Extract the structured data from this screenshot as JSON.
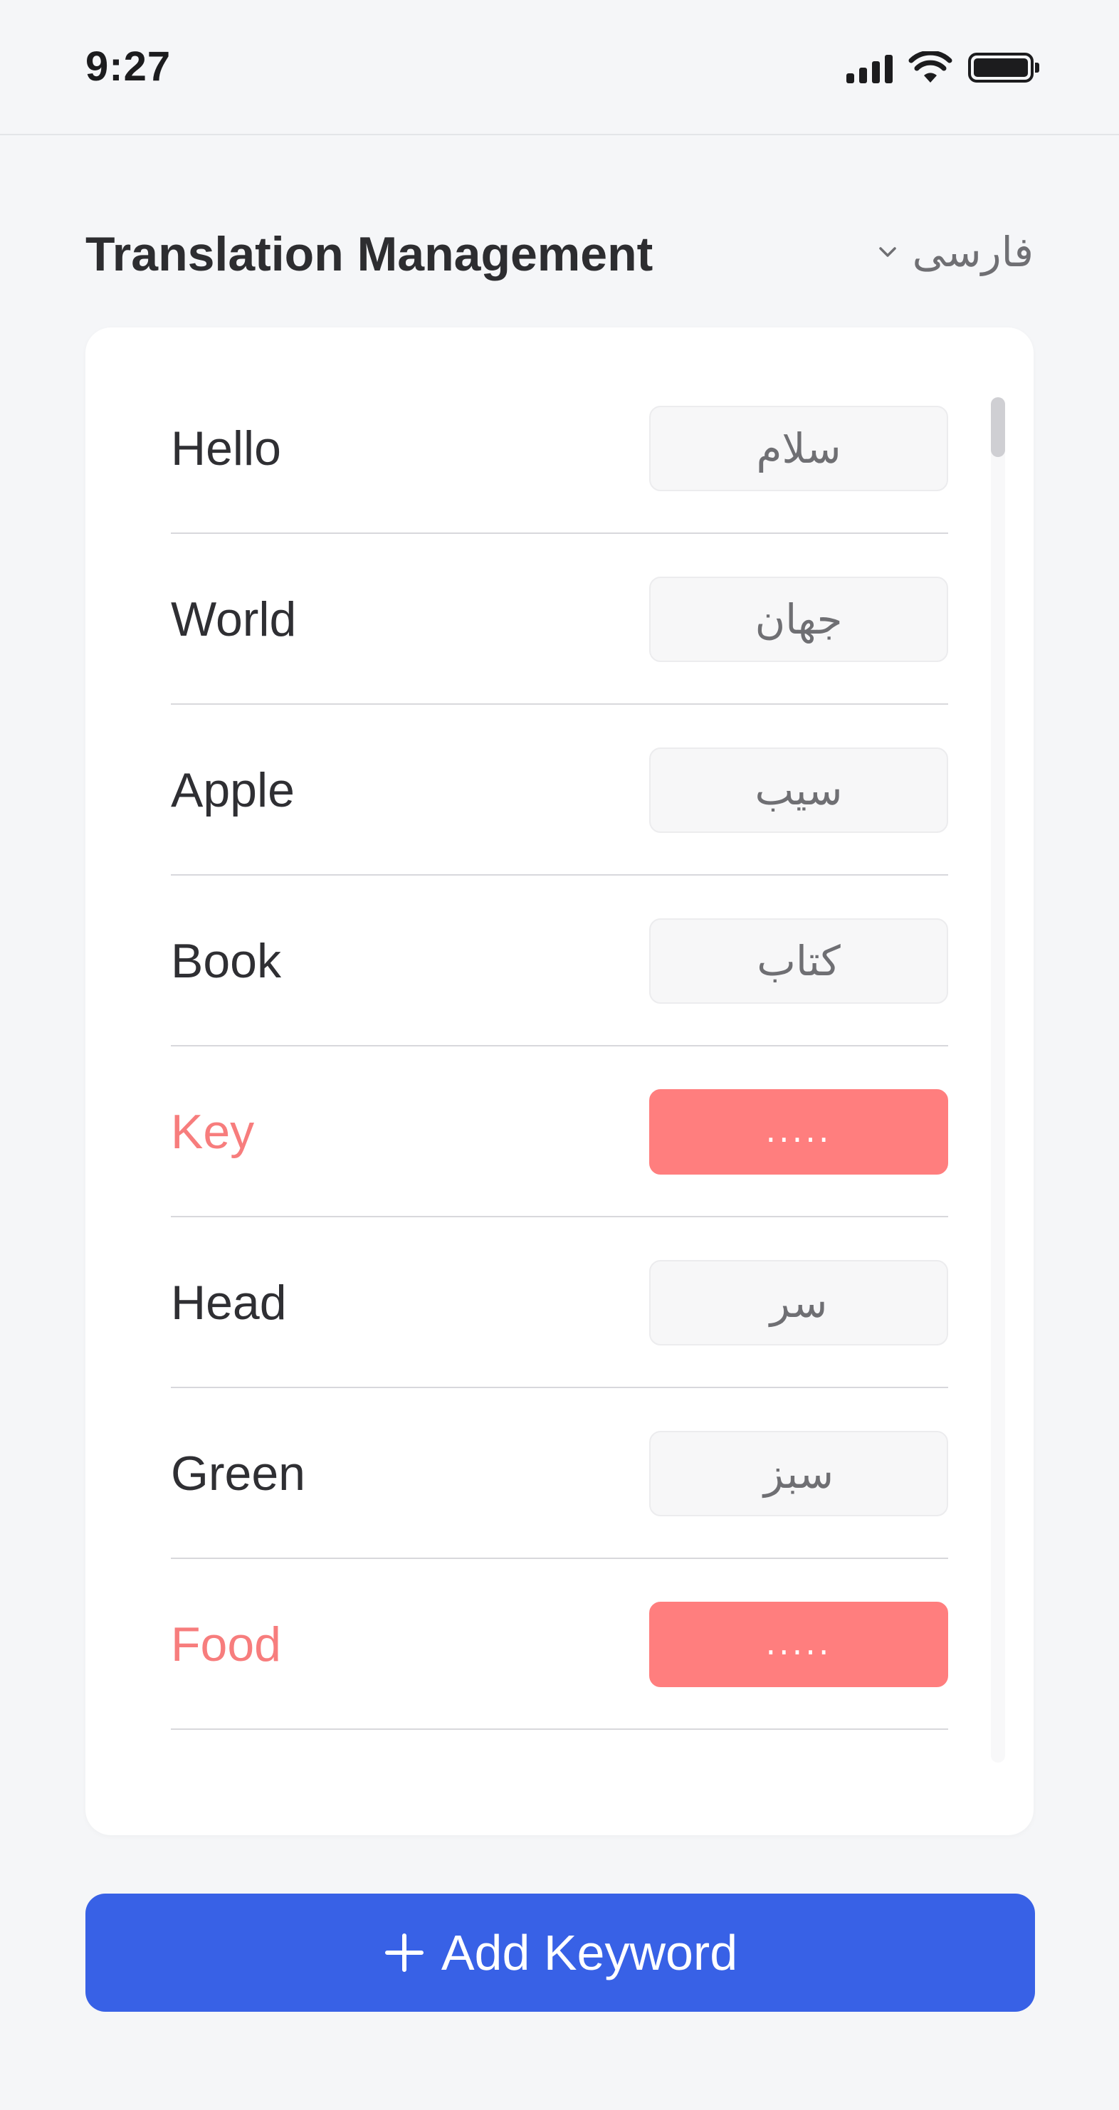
{
  "status_bar": {
    "time": "9:27",
    "icons": [
      "signal-icon",
      "wifi-icon",
      "battery-icon"
    ]
  },
  "header": {
    "title": "Translation Management",
    "language": "فارسی",
    "dropdown_icon": "chevron-down-icon"
  },
  "rows": [
    {
      "keyword": "Hello",
      "translation": "سلام"
    },
    {
      "keyword": "World",
      "translation": "جهان"
    },
    {
      "keyword": "Apple",
      "translation": "سیب"
    },
    {
      "keyword": "Book",
      "translation": "کتاب"
    },
    {
      "keyword": "Key",
      "translation": "....."
    },
    {
      "keyword": "Head",
      "translation": "سر"
    },
    {
      "keyword": "Green",
      "translation": "سبز"
    },
    {
      "keyword": "Food",
      "translation": "....."
    }
  ],
  "add_button": {
    "label": "Add Keyword",
    "icon": "plus-icon"
  },
  "colors": {
    "accent": "#3861e6",
    "missing": "#ff7e7e",
    "background": "#f5f6f8"
  }
}
